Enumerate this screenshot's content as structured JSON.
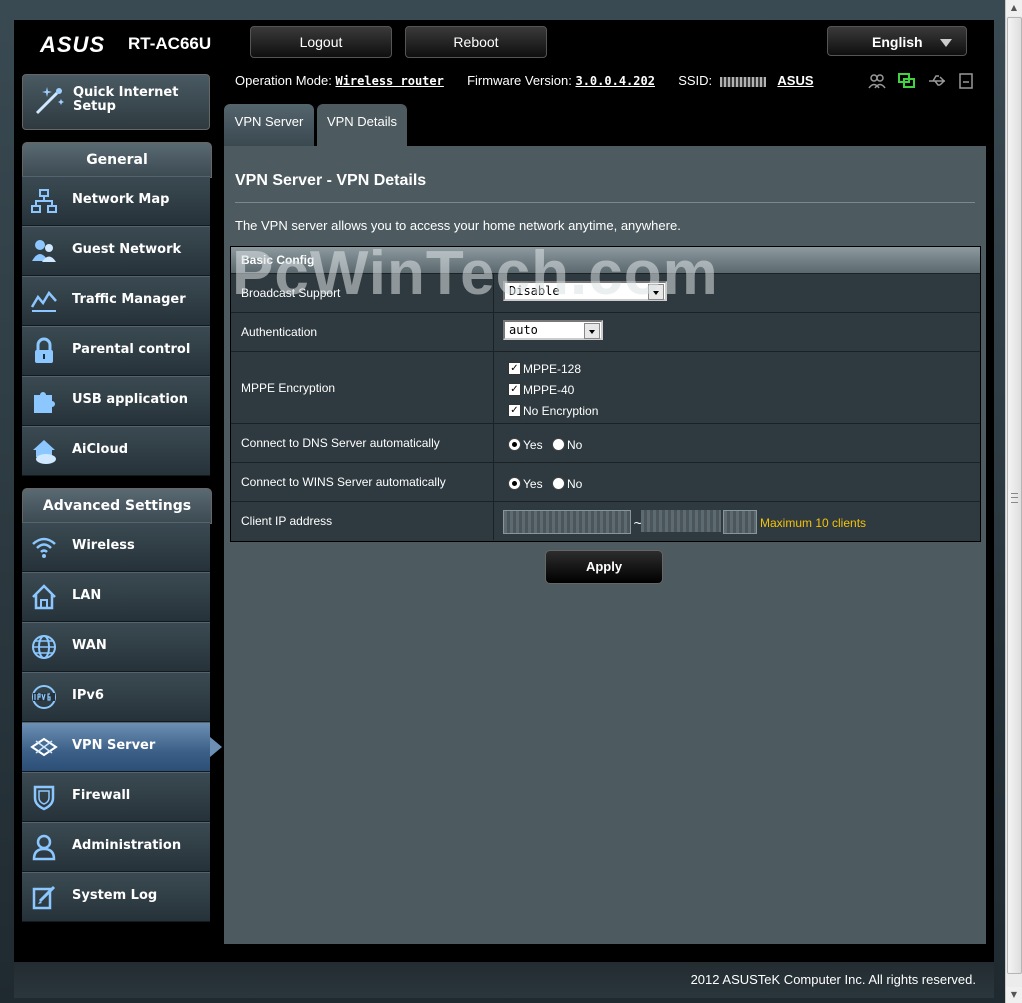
{
  "header": {
    "brand": "ASUS",
    "model": "RT-AC66U",
    "logout_label": "Logout",
    "reboot_label": "Reboot",
    "language": "English"
  },
  "sidebar": {
    "quick_setup_line1": "Quick Internet",
    "quick_setup_line2": "Setup",
    "general_title": "General",
    "general_items": [
      {
        "label": "Network Map",
        "icon": "network-map-icon"
      },
      {
        "label": "Guest Network",
        "icon": "guest-network-icon"
      },
      {
        "label": "Traffic Manager",
        "icon": "traffic-manager-icon"
      },
      {
        "label": "Parental control",
        "icon": "lock-icon"
      },
      {
        "label": "USB application",
        "icon": "puzzle-icon"
      },
      {
        "label": "AiCloud",
        "icon": "cloud-icon"
      }
    ],
    "advanced_title": "Advanced Settings",
    "advanced_items": [
      {
        "label": "Wireless",
        "icon": "wifi-icon"
      },
      {
        "label": "LAN",
        "icon": "home-icon"
      },
      {
        "label": "WAN",
        "icon": "globe-icon"
      },
      {
        "label": "IPv6",
        "icon": "ipv6-icon"
      },
      {
        "label": "VPN Server",
        "icon": "vpn-icon",
        "active": true
      },
      {
        "label": "Firewall",
        "icon": "shield-icon"
      },
      {
        "label": "Administration",
        "icon": "user-icon"
      },
      {
        "label": "System Log",
        "icon": "log-icon"
      }
    ]
  },
  "infobar": {
    "op_mode_label": "Operation Mode:",
    "op_mode_value": "Wireless router",
    "firmware_label": "Firmware Version:",
    "firmware_value": "3.0.0.4.202",
    "ssid_label": "SSID:",
    "ssid_value": "ASUS"
  },
  "tabs": {
    "vpn_server": "VPN Server",
    "vpn_details": "VPN Details"
  },
  "main": {
    "title": "VPN Server - VPN Details",
    "description": "The VPN server allows you to access your home network anytime, anywhere.",
    "section_title": "Basic Config",
    "broadcast_label": "Broadcast Support",
    "broadcast_value": "Disable",
    "auth_label": "Authentication",
    "auth_value": "auto",
    "mppe_label": "MPPE Encryption",
    "mppe_options": [
      "MPPE-128",
      "MPPE-40",
      "No Encryption"
    ],
    "dns_label": "Connect to DNS Server automatically",
    "wins_label": "Connect to WINS Server automatically",
    "yes": "Yes",
    "no": "No",
    "client_ip_label": "Client IP address",
    "ip_sep": "~",
    "max_clients": "Maximum 10 clients",
    "apply_label": "Apply"
  },
  "watermark": "PcWinTech.com",
  "footer": {
    "copyright": "2012 ASUSTeK Computer Inc. All rights reserved."
  }
}
